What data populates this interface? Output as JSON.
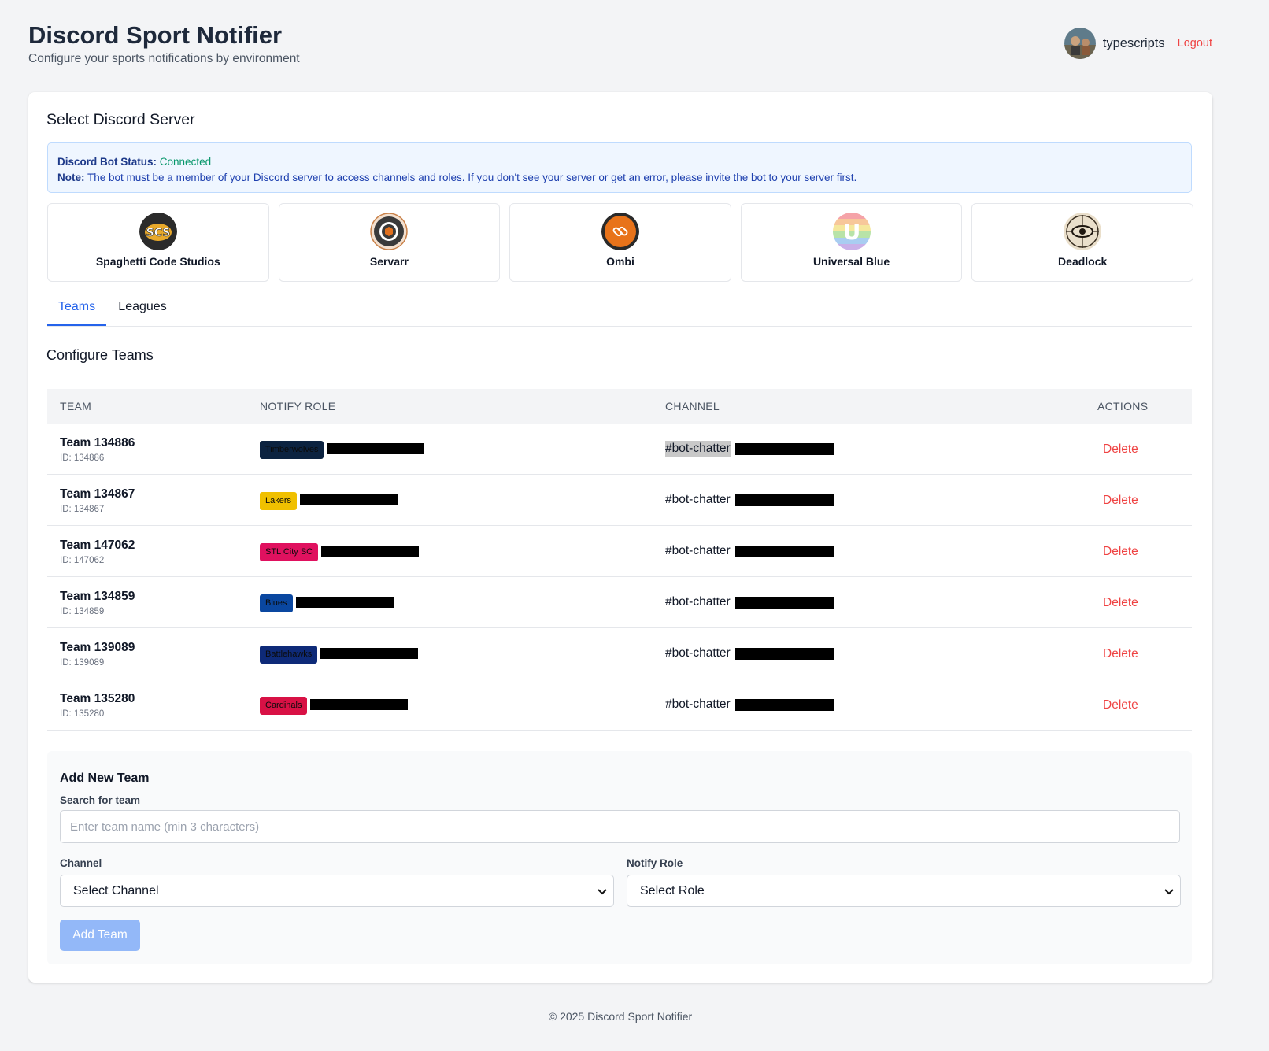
{
  "header": {
    "title": "Discord Sport Notifier",
    "subtitle": "Configure your sports notifications by environment",
    "username": "typescripts",
    "logout_label": "Logout"
  },
  "server_section": {
    "title": "Select Discord Server",
    "status_label": "Discord Bot Status:",
    "status_value": "Connected",
    "note_label": "Note:",
    "note_text": " The bot must be a member of your Discord server to access channels and roles. If you don't see your server or get an error, please invite the bot to your server first."
  },
  "servers": [
    {
      "name": "Spaghetti Code Studios",
      "icon": "scs-logo-icon",
      "icon_text": "SCS"
    },
    {
      "name": "Servarr",
      "icon": "servarr-logo-icon"
    },
    {
      "name": "Ombi",
      "icon": "ombi-logo-icon"
    },
    {
      "name": "Universal Blue",
      "icon": "universal-blue-logo-icon",
      "icon_text": "U"
    },
    {
      "name": "Deadlock",
      "icon": "deadlock-logo-icon"
    }
  ],
  "tabs": [
    {
      "label": "Teams",
      "active": true
    },
    {
      "label": "Leagues",
      "active": false
    }
  ],
  "teams_section": {
    "title": "Configure Teams"
  },
  "table": {
    "headers": {
      "team": "TEAM",
      "role": "NOTIFY ROLE",
      "channel": "CHANNEL",
      "actions": "ACTIONS"
    },
    "delete_label": "Delete",
    "rows": [
      {
        "team": "Team 134886",
        "id": "ID: 134886",
        "role": "Timberwolves",
        "role_color": "#0c2340",
        "channel": "#bot-chatter"
      },
      {
        "team": "Team 134867",
        "id": "ID: 134867",
        "role": "Lakers",
        "role_color": "#f0c000",
        "channel": "#bot-chatter"
      },
      {
        "team": "Team 147062",
        "id": "ID: 147062",
        "role": "STL City SC",
        "role_color": "#e0115f",
        "channel": "#bot-chatter"
      },
      {
        "team": "Team 134859",
        "id": "ID: 134859",
        "role": "Blues",
        "role_color": "#0a47a0",
        "channel": "#bot-chatter"
      },
      {
        "team": "Team 139089",
        "id": "ID: 139089",
        "role": "Battlehawks",
        "role_color": "#0e2a78",
        "channel": "#bot-chatter"
      },
      {
        "team": "Team 135280",
        "id": "ID: 135280",
        "role": "Cardinals",
        "role_color": "#d81145",
        "channel": "#bot-chatter"
      }
    ]
  },
  "add_team": {
    "title": "Add New Team",
    "search_label": "Search for team",
    "search_placeholder": "Enter team name (min 3 characters)",
    "channel_label": "Channel",
    "channel_value": "Select Channel",
    "role_label": "Notify Role",
    "role_value": "Select Role",
    "button_label": "Add Team"
  },
  "footer": {
    "text": "© 2025 Discord Sport Notifier"
  },
  "colors": {
    "accent": "#2563eb",
    "danger": "#ef4444",
    "connected": "#059669"
  }
}
